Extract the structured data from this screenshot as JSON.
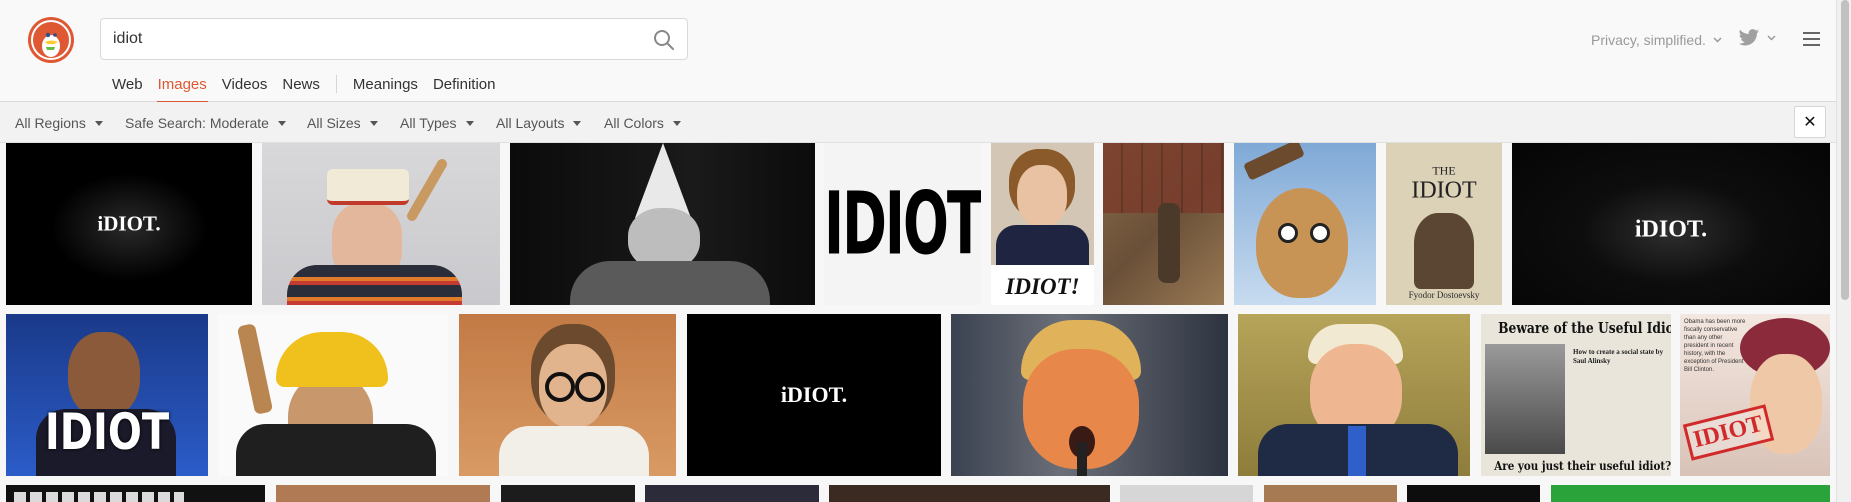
{
  "search": {
    "query": "idiot"
  },
  "nav": {
    "web": "Web",
    "images": "Images",
    "videos": "Videos",
    "news": "News",
    "meanings": "Meanings",
    "definition": "Definition"
  },
  "header": {
    "privacy": "Privacy, simplified."
  },
  "filters": {
    "regions": "All Regions",
    "safe_search": "Safe Search: Moderate",
    "sizes": "All Sizes",
    "types": "All Types",
    "layouts": "All Layouts",
    "colors": "All Colors",
    "close": "✕"
  },
  "images": {
    "t1": "iDIOT.",
    "t4": "IDIOT",
    "t5": "IDIOT!",
    "t8_title": "THE",
    "t8_title2": "IDIOT",
    "t8_author": "Fyodor Dostoevsky",
    "t9": "iDIOT.",
    "t10": "IDIOT",
    "t13": "iDIOT.",
    "t16_header": "Beware of the Useful Idiots",
    "t16_body": "How to create a social state by Saul Alinsky",
    "t16_footer": "Are you just their useful idiot?",
    "t17_stamp": "IDIOT",
    "t17_quote": "Obama has been more fiscally conservative than any other president in recent history, with the exception of President Bill Clinton."
  },
  "colors": {
    "accent": "#de5833",
    "logo": "#de5833",
    "twitter": "#a0a0a0"
  },
  "icons": [
    "duckduckgo-logo",
    "search-icon",
    "chevron-down-icon",
    "twitter-icon",
    "hamburger-menu-icon",
    "close-icon"
  ]
}
